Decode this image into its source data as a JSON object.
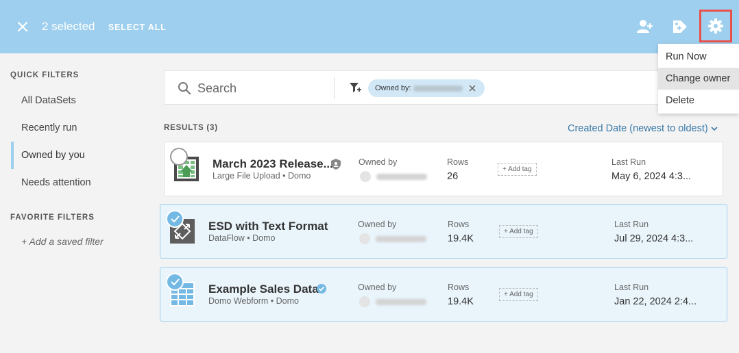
{
  "topbar": {
    "selected_text": "2 selected",
    "select_all": "SELECT ALL"
  },
  "menu": {
    "items": [
      "Run Now",
      "Change owner",
      "Delete"
    ],
    "hovered_index": 1
  },
  "sidebar": {
    "quick_filters_heading": "QUICK FILTERS",
    "quick_filters": [
      "All DataSets",
      "Recently run",
      "Owned by you",
      "Needs attention"
    ],
    "active_index": 2,
    "favorite_filters_heading": "FAVORITE FILTERS",
    "add_saved_filter": "+ Add a saved filter"
  },
  "search": {
    "placeholder": "Search",
    "chip_label": "Owned by:"
  },
  "results": {
    "label": "RESULTS (3)",
    "sort": "Created Date (newest to oldest)",
    "owned_by_label": "Owned by",
    "rows_label": "Rows",
    "last_run_label": "Last Run",
    "add_tag": "+ Add tag",
    "items": [
      {
        "name": "March 2023 Release...",
        "sub": "Large File Upload • Domo",
        "rows": "26",
        "last_run": "May 6, 2024 4:3...",
        "selected": false,
        "badge": "shield-icon"
      },
      {
        "name": "ESD with Text Format",
        "sub": "DataFlow • Domo",
        "rows": "19.4K",
        "last_run": "Jul 29, 2024 4:3...",
        "selected": true,
        "badge": ""
      },
      {
        "name": "Example Sales Data",
        "sub": "Domo Webform • Domo",
        "rows": "19.4K",
        "last_run": "Jan 22, 2024 2:4...",
        "selected": true,
        "badge": "verified-icon"
      }
    ]
  },
  "colors": {
    "topbar": "#9ecfee",
    "accent_link": "#3a79a8",
    "highlight_box": "#e8514a",
    "selected_card": "#e9f4fb",
    "check_on": "#74b9e3"
  }
}
